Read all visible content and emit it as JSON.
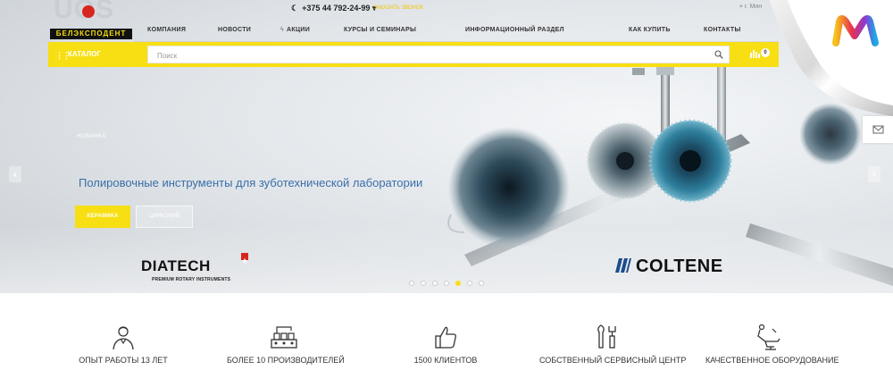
{
  "header": {
    "logo_top": "UOS",
    "logo_strip": "БЕЛЭКСПОДЕНТ",
    "phone": "+375 44 792-24-99",
    "callback_label": "ЗАКАЗАТЬ ЗВОНОК",
    "city": "г. Мин"
  },
  "nav": {
    "items": [
      "КОМПАНИЯ",
      "НОВОСТИ",
      "АКЦИИ",
      "КУРСЫ И СЕМИНАРЫ",
      "ИНФОРМАЦИОННЫЙ РАЗДЕЛ",
      "КАК КУПИТЬ",
      "КОНТАКТЫ"
    ]
  },
  "catalog_bar": {
    "catalog_label": "КАТАЛОГ",
    "search_placeholder": "Поиск",
    "compare_count": "0"
  },
  "slide": {
    "tag": "НОВИНКА",
    "title": "Полировочные инструменты для зуботехнической лаборатории",
    "btn_primary": "КЕРАМИКА",
    "btn_secondary": "ЦИРКОНИЙ",
    "brand_left": "DIATECH",
    "brand_left_sub": "PREMIUM ROTARY INSTRUMENTS",
    "brand_right": "COLTENE",
    "dots_total": 7,
    "dots_active_index": 4
  },
  "features": [
    {
      "label": "ОПЫТ РАБОТЫ 13 ЛЕТ",
      "icon": "doctor-icon"
    },
    {
      "label": "БОЛЕЕ 10 ПРОИЗВОДИТЕЛЕЙ",
      "icon": "factory-icon"
    },
    {
      "label": "1500 КЛИЕНТОВ",
      "icon": "thumbs-up-icon"
    },
    {
      "label": "СОБСТВЕННЫЙ СЕРВИСНЫЙ ЦЕНТР",
      "icon": "tools-icon"
    },
    {
      "label": "КАЧЕСТВЕННОЕ ОБОРУДОВАНИЕ",
      "icon": "dental-chair-icon"
    }
  ],
  "colors": {
    "accent_yellow": "#f7df14",
    "title_blue": "#3a6fa8"
  }
}
